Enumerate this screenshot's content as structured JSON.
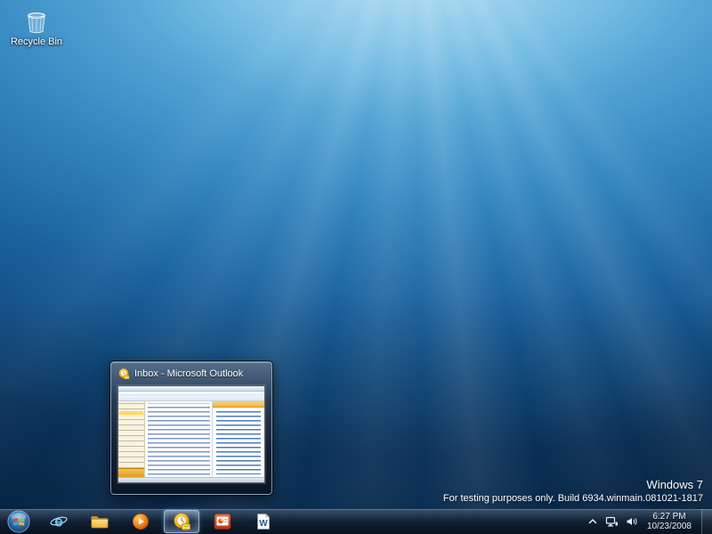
{
  "desktop": {
    "recycle_bin": {
      "label": "Recycle Bin"
    },
    "watermark": {
      "line1": "Windows 7",
      "line2": "For testing purposes only. Build 6934.winmain.081021-1817"
    }
  },
  "preview": {
    "title": "Inbox - Microsoft Outlook"
  },
  "taskbar": {
    "buttons": [
      {
        "id": "start"
      },
      {
        "id": "internet-explorer"
      },
      {
        "id": "windows-explorer"
      },
      {
        "id": "windows-media-player"
      },
      {
        "id": "outlook",
        "active": true
      },
      {
        "id": "powerpoint"
      },
      {
        "id": "word"
      }
    ],
    "tray": {
      "clock": {
        "time": "6:27 PM",
        "date": "10/23/2008"
      }
    }
  },
  "colors": {
    "wallpaper_light": "#a8daf2",
    "wallpaper_dark": "#0c3a66",
    "taskbar_glass": "#13253a",
    "active_button_glow": "#9cc8f0",
    "outlook_gold": "#f7b521",
    "flag_red": "#e8452c",
    "flag_green": "#8dc63f",
    "flag_blue": "#36a9e1",
    "flag_yellow": "#fbb040"
  }
}
